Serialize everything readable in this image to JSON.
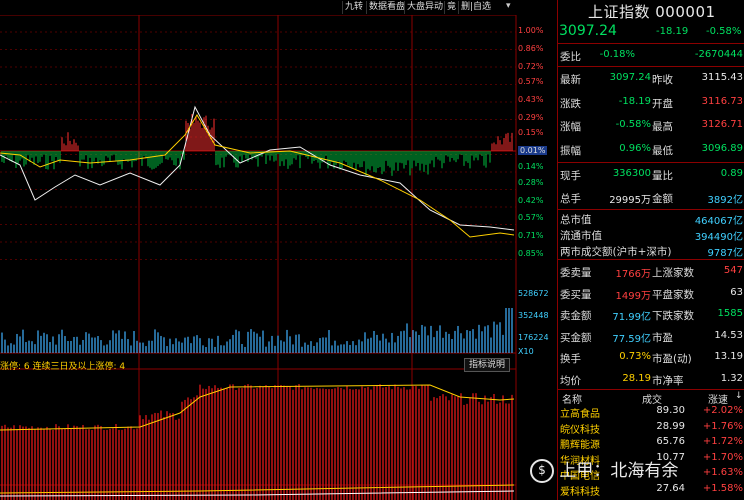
{
  "toolbar": {
    "buttons": [
      "九转",
      "数据看盘",
      "大盘异动",
      "竟",
      "删|自选"
    ],
    "icons": [
      "eye-icon",
      "history-icon",
      "gear-icon",
      "circle-icon",
      "close-icon",
      "down-icon"
    ]
  },
  "axis": {
    "pct_top": [
      "1.00%",
      "0.86%",
      "0.72%",
      "0.57%",
      "0.43%",
      "0.29%",
      "0.15%"
    ],
    "pct_mid": "0.01%",
    "pct_bottom": [
      "0.14%",
      "0.28%",
      "0.42%",
      "0.57%",
      "0.71%",
      "0.85%"
    ],
    "vol": [
      "528672",
      "352448",
      "176224"
    ],
    "vol_unit": "X10"
  },
  "indicator": {
    "title": "涨停: 6  连续三日及以上涨停: 4",
    "help_button": "指标说明"
  },
  "panel": {
    "title": "上证指数 000001",
    "price": "3097.24",
    "change": "-18.19",
    "change_pct": "-0.58%",
    "weibi_label": "委比",
    "weibi_pct": "-0.18%",
    "weibi_val": "-2670444",
    "rows1": [
      {
        "l1": "最新",
        "v1": "3097.24",
        "c1": "green",
        "l2": "昨收",
        "v2": "3115.43",
        "c2": "white"
      },
      {
        "l1": "涨跌",
        "v1": "-18.19",
        "c1": "green",
        "l2": "开盘",
        "v2": "3116.73",
        "c2": "red"
      },
      {
        "l1": "涨幅",
        "v1": "-0.58%",
        "c1": "green",
        "l2": "最高",
        "v2": "3126.71",
        "c2": "red"
      },
      {
        "l1": "振幅",
        "v1": "0.96%",
        "c1": "green",
        "l2": "最低",
        "v2": "3096.89",
        "c2": "green"
      }
    ],
    "rows2": [
      {
        "l1": "现手",
        "v1": "336300",
        "c1": "green",
        "l2": "量比",
        "v2": "0.89",
        "c2": "green"
      },
      {
        "l1": "总手",
        "v1": "29995万",
        "c1": "white",
        "l2": "金额",
        "v2": "3892亿",
        "c2": "cyan"
      }
    ],
    "mkt": [
      {
        "l": "总市值",
        "v": "464067亿"
      },
      {
        "l": "流通市值",
        "v": "394490亿"
      },
      {
        "l": "两市成交额(沪市+深市)",
        "v": "9787亿"
      }
    ],
    "rows3": [
      {
        "l1": "委卖量",
        "v1": "1766万",
        "c1": "red",
        "l2": "上涨家数",
        "v2": "547",
        "c2": "red"
      },
      {
        "l1": "委买量",
        "v1": "1499万",
        "c1": "red",
        "l2": "平盘家数",
        "v2": "63",
        "c2": "white"
      },
      {
        "l1": "卖金额",
        "v1": "71.99亿",
        "c1": "cyan",
        "l2": "下跌家数",
        "v2": "1585",
        "c2": "green"
      },
      {
        "l1": "买金额",
        "v1": "77.59亿",
        "c1": "cyan",
        "l2": "市盈",
        "v2": "14.53",
        "c2": "white"
      },
      {
        "l1": "换手",
        "v1": "0.73%",
        "c1": "yellow",
        "l2": "市盈(动)",
        "v2": "13.19",
        "c2": "white"
      },
      {
        "l1": "均价",
        "v1": "28.19",
        "c1": "yellow",
        "l2": "市净率",
        "v2": "1.32",
        "c2": "white"
      }
    ],
    "stock_header": {
      "name": "名称",
      "volume": "成交",
      "change": "涨速"
    },
    "stocks": [
      {
        "name": "立高食品",
        "price": "89.30",
        "chg": "+2.02%"
      },
      {
        "name": "皖仪科技",
        "price": "28.99",
        "chg": "+1.76%"
      },
      {
        "name": "鹏辉能源",
        "price": "65.76",
        "chg": "+1.72%"
      },
      {
        "name": "华润材料",
        "price": "10.77",
        "chg": "+1.70%"
      },
      {
        "name": "中国电信",
        "price": "",
        "chg": "+1.63%"
      },
      {
        "name": "爱科科技",
        "price": "27.64",
        "chg": "+1.58%"
      }
    ]
  },
  "watermark": "上甲：北海有余",
  "colors": {
    "up": "#ff4040",
    "down": "#00e060",
    "grid": "#8b0000",
    "accent_yellow": "#ffd000"
  }
}
